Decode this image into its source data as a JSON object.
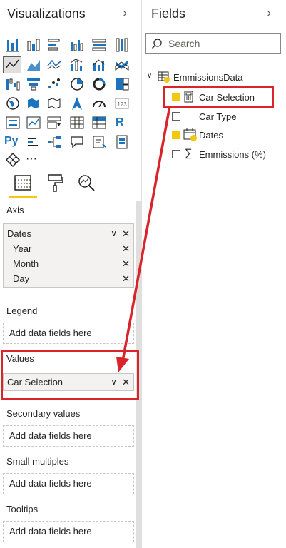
{
  "visualizations": {
    "title": "Visualizations",
    "collapse_icon": "chevron-right-icon",
    "more_label": "···",
    "r_label": "R",
    "py_label": "Py",
    "tabs": [
      "fields-tab",
      "format-tab",
      "analytics-tab"
    ],
    "wells": {
      "axis": {
        "label": "Axis",
        "items": [
          {
            "label": "Dates",
            "indent": false
          },
          {
            "label": "Year",
            "indent": true
          },
          {
            "label": "Month",
            "indent": true
          },
          {
            "label": "Day",
            "indent": true
          }
        ]
      },
      "legend": {
        "label": "Legend",
        "placeholder": "Add data fields here"
      },
      "values": {
        "label": "Values",
        "field": "Car Selection"
      },
      "secondary_values": {
        "label": "Secondary values",
        "placeholder": "Add data fields here"
      },
      "small_multiples": {
        "label": "Small multiples",
        "placeholder": "Add data fields here"
      },
      "tooltips": {
        "label": "Tooltips",
        "placeholder": "Add data fields here"
      }
    }
  },
  "fields": {
    "title": "Fields",
    "collapse_icon": "chevron-right-icon",
    "search_placeholder": "Search",
    "table_name": "EmmissionsData",
    "items": [
      {
        "label": "Car Selection",
        "checked": true,
        "icon": "calculator-icon"
      },
      {
        "label": "Car Type",
        "checked": false,
        "icon": ""
      },
      {
        "label": "Dates",
        "checked": true,
        "icon": "calendar-icon"
      },
      {
        "label": "Emmissions (%)",
        "checked": false,
        "icon": "sigma-icon"
      }
    ]
  },
  "colors": {
    "accent": "#f2c811",
    "highlight": "#d8242a",
    "icon_blue": "#1e73be"
  }
}
